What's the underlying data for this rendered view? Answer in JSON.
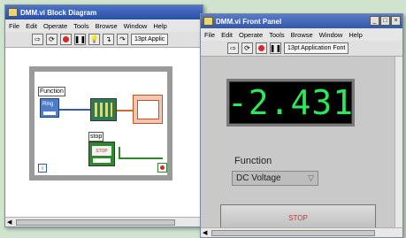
{
  "block_diagram": {
    "title": "DMM.vi Block Diagram",
    "menu": [
      "File",
      "Edit",
      "Operate",
      "Tools",
      "Browse",
      "Window",
      "Help"
    ],
    "font_label": "13pt Applic",
    "nodes": {
      "function_label": "Function",
      "function_term": "Ring",
      "stop_label": "stop",
      "stop_term": "STOP",
      "iteration": "i"
    }
  },
  "front_panel": {
    "title": "DMM.vi Front Panel",
    "menu": [
      "File",
      "Edit",
      "Operate",
      "Tools",
      "Browse",
      "Window",
      "Help"
    ],
    "font_label": "13pt Application Font",
    "window_buttons": [
      "_",
      "□",
      "×"
    ],
    "reading": "-2.431",
    "function_label": "Function",
    "function_value": "DC Voltage",
    "stop_label": "STOP"
  },
  "colors": {
    "display_text": "#2be85a",
    "stop_text": "#d23030",
    "titlebar": "#3358a8"
  }
}
